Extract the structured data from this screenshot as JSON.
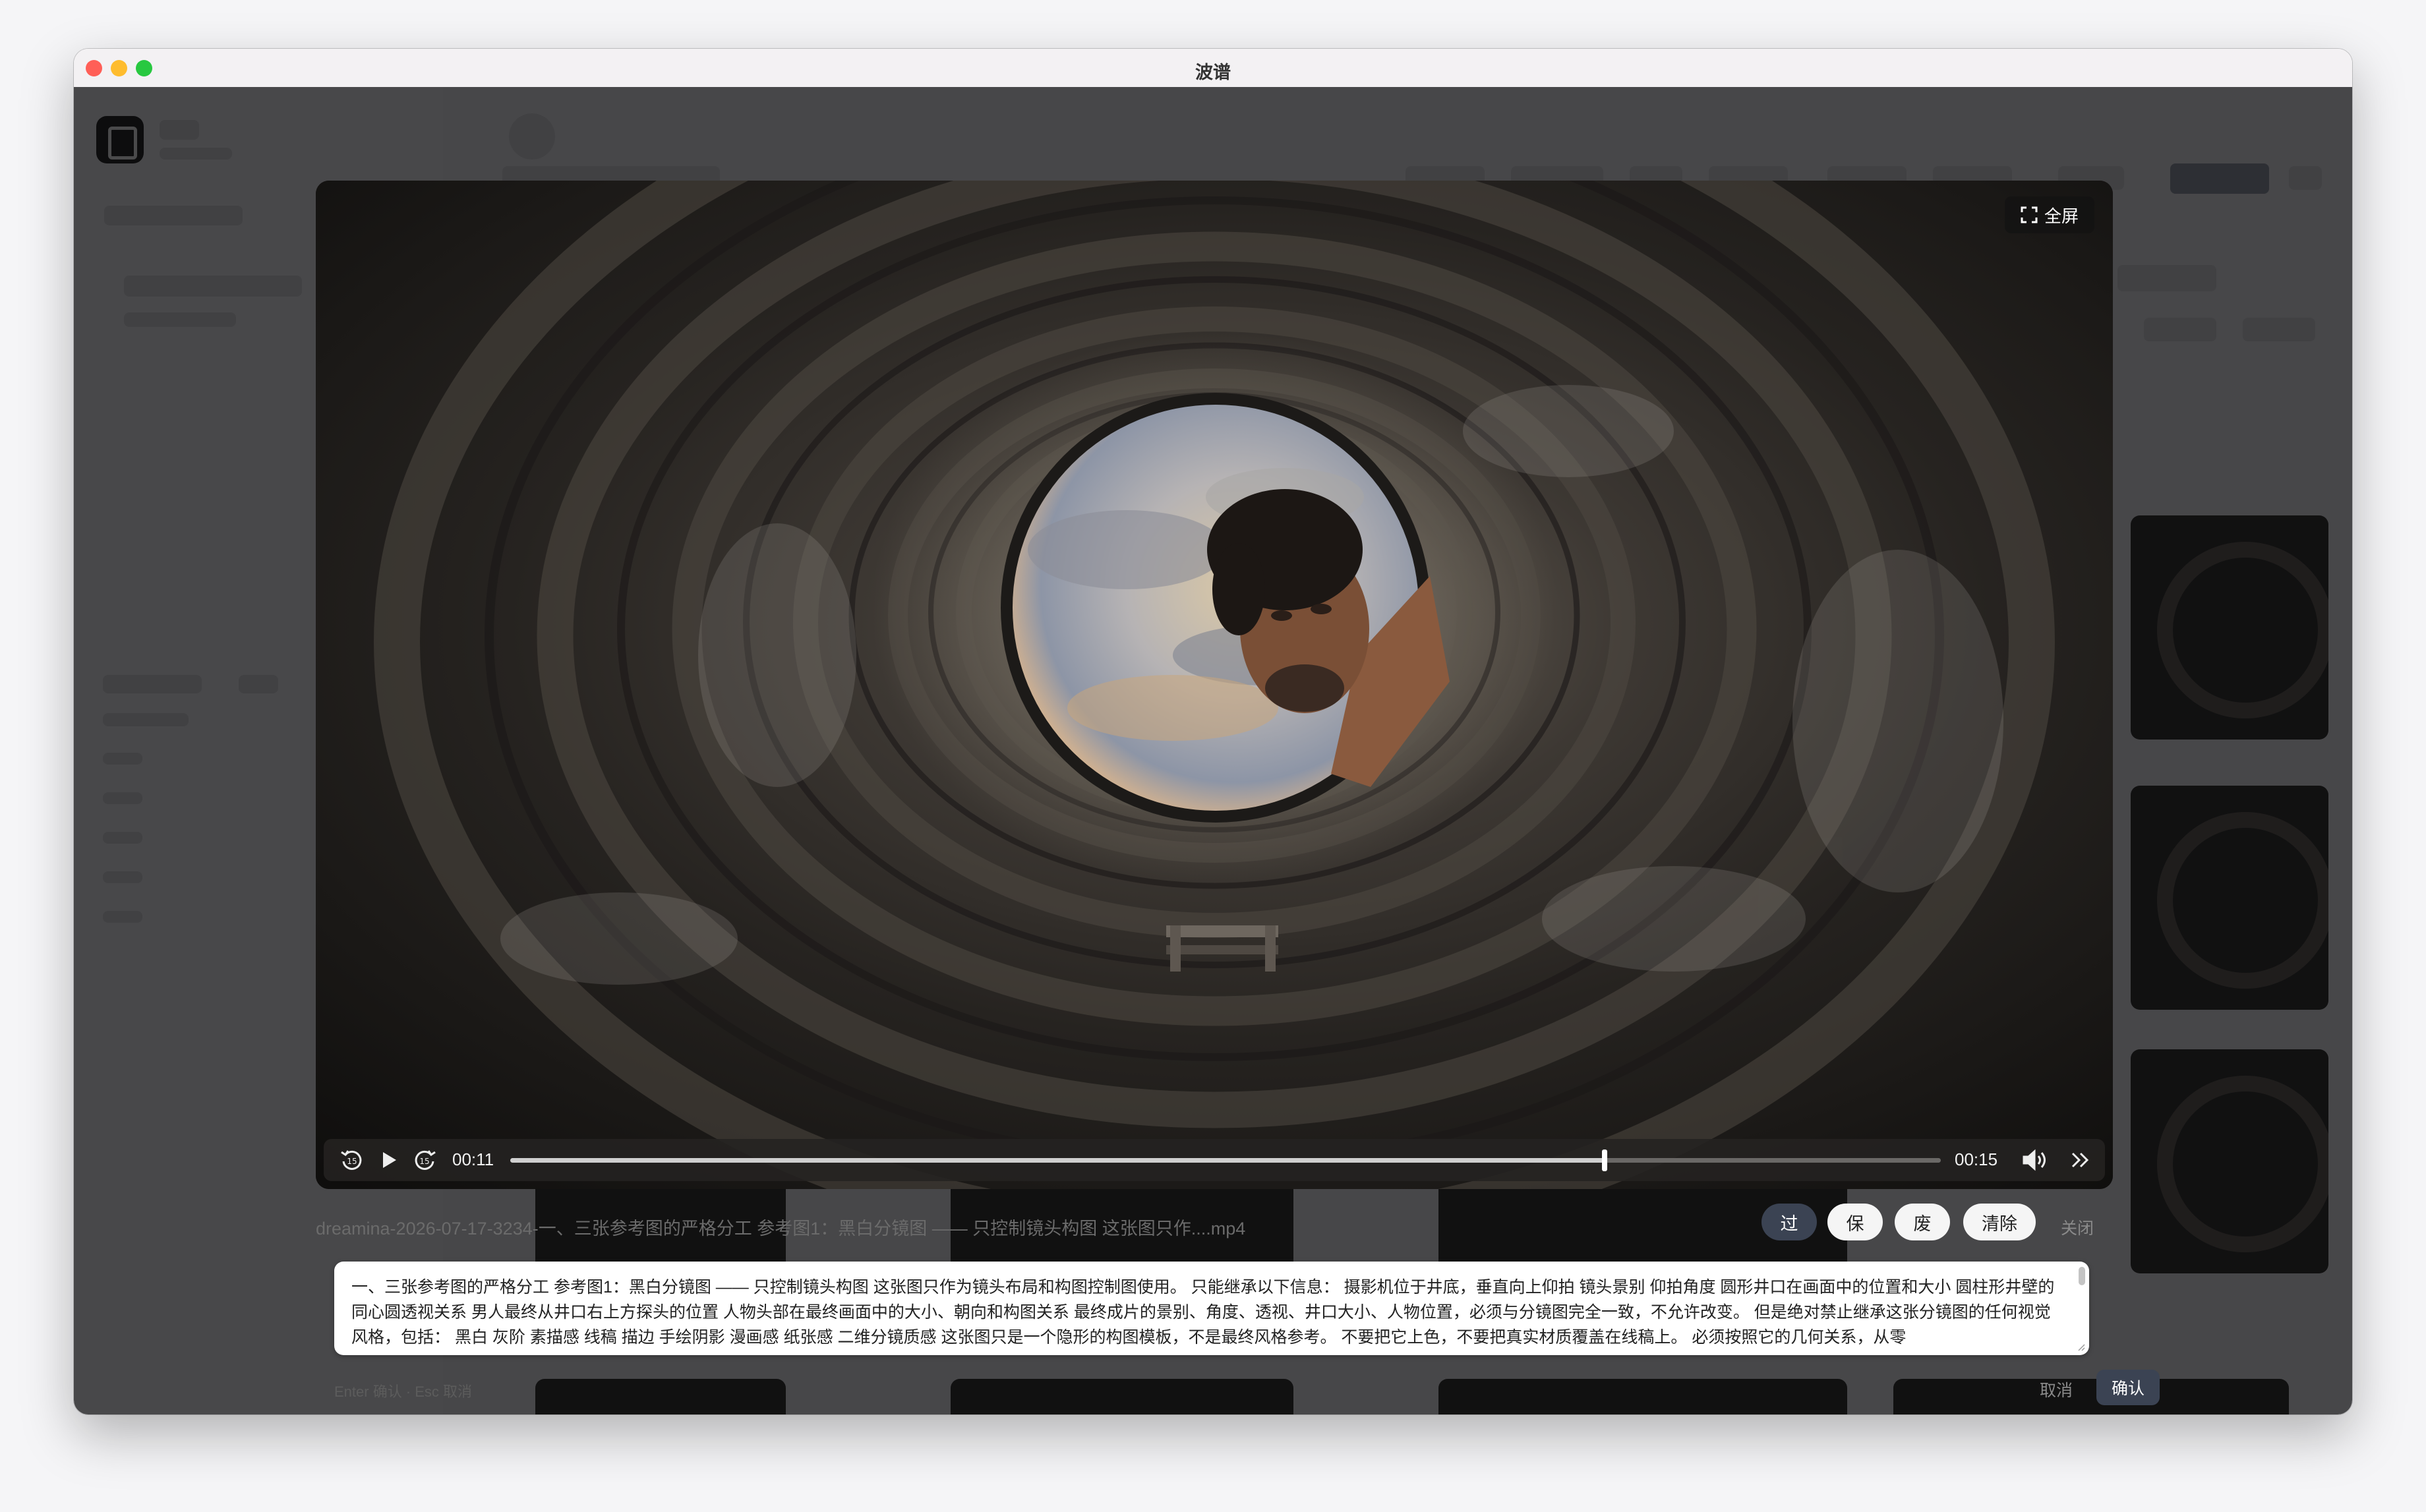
{
  "window": {
    "title": "波谱"
  },
  "player": {
    "fullscreen_label": "全屏",
    "current_time": "00:11",
    "duration": "00:15",
    "progress_fraction": 0.765
  },
  "file": {
    "name": "dreamina-2026-07-17-3234-一、三张参考图的严格分工 参考图1：黑白分镜图 —— 只控制镜头构图 这张图只作....mp4"
  },
  "actions": {
    "pass": "过",
    "keep": "保",
    "discard": "废",
    "clear": "清除",
    "close": "关闭"
  },
  "prompt": {
    "text": "一、三张参考图的严格分工 参考图1：黑白分镜图 —— 只控制镜头构图 这张图只作为镜头布局和构图控制图使用。 只能继承以下信息： 摄影机位于井底，垂直向上仰拍 镜头景别 仰拍角度 圆形井口在画面中的位置和大小 圆柱形井壁的同心圆透视关系 男人最终从井口右上方探头的位置 人物头部在最终画面中的大小、朝向和构图关系 最终成片的景别、角度、透视、井口大小、人物位置，必须与分镜图完全一致，不允许改变。 但是绝对禁止继承这张分镜图的任何视觉风格，包括： 黑白 灰阶 素描感 线稿 描边 手绘阴影 漫画感 纸张感 二维分镜质感 这张图只是一个隐形的构图模板，不是最终风格参考。 不要把它上色，不要把真实材质覆盖在线稿上。 必须按照它的几何关系，从零"
  },
  "footer": {
    "hint": "Enter 确认 · Esc 取消",
    "cancel": "取消",
    "confirm": "确认"
  }
}
